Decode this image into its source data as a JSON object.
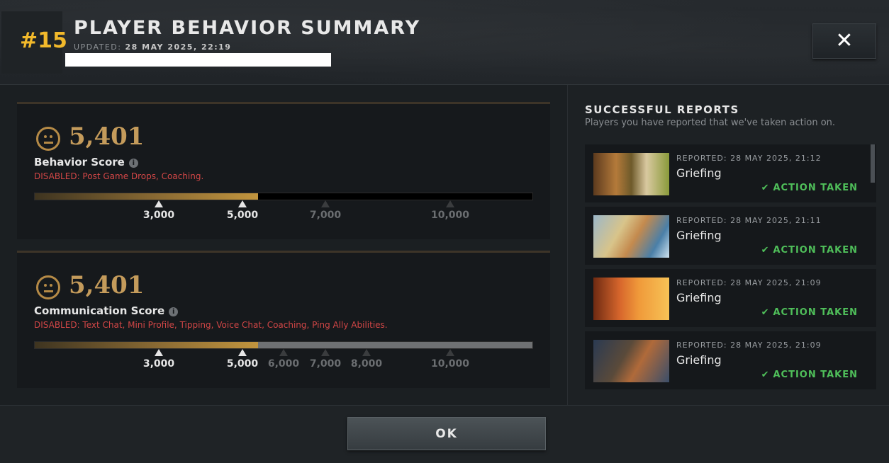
{
  "header": {
    "rank": "#15",
    "title": "PLAYER BEHAVIOR SUMMARY",
    "updated_label": "UPDATED:",
    "updated_value": "28 MAY 2025, 22:19",
    "close_label": "✕"
  },
  "behavior": {
    "score": "5,401",
    "label": "Behavior Score",
    "info_glyph": "i",
    "disabled": "DISABLED:  Post Game Drops, Coaching.",
    "fill_fraction": 0.449,
    "ticks": [
      {
        "label": "3,000",
        "on": true
      },
      {
        "label": "5,000",
        "on": true
      },
      {
        "label": "7,000",
        "on": false
      },
      {
        "label": "10,000",
        "on": false
      }
    ]
  },
  "communication": {
    "score": "5,401",
    "label": "Communication Score",
    "info_glyph": "i",
    "disabled": "DISABLED:  Text Chat, Mini Profile, Tipping, Voice Chat, Coaching, Ping Ally Abilities.",
    "fill_fraction": 0.449,
    "ticks": [
      {
        "label": "3,000",
        "on": true
      },
      {
        "label": "5,000",
        "on": true
      },
      {
        "label": "6,000",
        "on": false
      },
      {
        "label": "7,000",
        "on": false
      },
      {
        "label": "8,000",
        "on": false
      },
      {
        "label": "10,000",
        "on": false
      }
    ]
  },
  "reports": {
    "title": "SUCCESSFUL REPORTS",
    "subtitle": "Players you have reported that we've taken action on.",
    "items": [
      {
        "time": "REPORTED: 28 MAY 2025, 21:12",
        "reason": "Griefing",
        "action": "ACTION TAKEN",
        "hero_icon": "hero-portrait-1"
      },
      {
        "time": "REPORTED: 28 MAY 2025, 21:11",
        "reason": "Griefing",
        "action": "ACTION TAKEN",
        "hero_icon": "hero-portrait-2"
      },
      {
        "time": "REPORTED: 28 MAY 2025, 21:09",
        "reason": "Griefing",
        "action": "ACTION TAKEN",
        "hero_icon": "hero-portrait-3"
      },
      {
        "time": "REPORTED: 28 MAY 2025, 21:09",
        "reason": "Griefing",
        "action": "ACTION TAKEN",
        "hero_icon": "hero-portrait-4"
      }
    ],
    "check_glyph": "✔"
  },
  "footer": {
    "ok_label": "OK"
  },
  "colors": {
    "rank": "#f2b92b",
    "score": "#c49b5b",
    "disabled": "#d14646",
    "action": "#4fbf5a"
  }
}
